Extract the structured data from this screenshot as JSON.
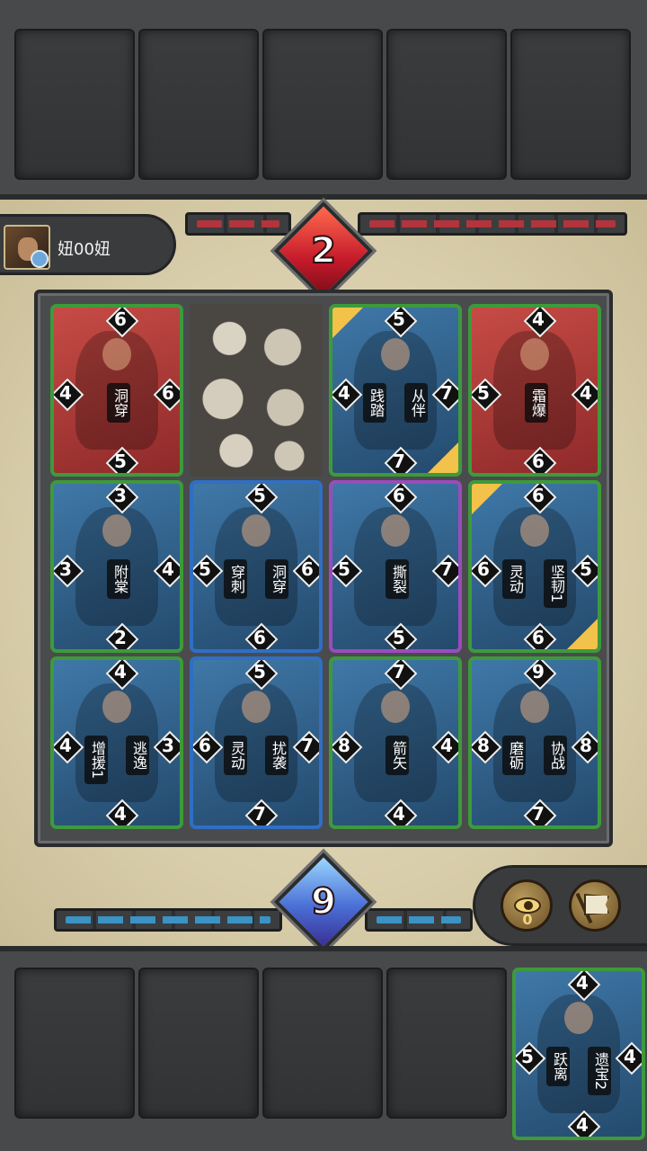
{
  "opponent": {
    "name": "妞00妞",
    "score": "2"
  },
  "player": {
    "score": "9",
    "view_count": "0"
  },
  "board": [
    {
      "owner": "red",
      "top": "6",
      "left": "4",
      "right": "6",
      "bottom": "5",
      "abilities": [
        "洞穿"
      ],
      "ability_pos": [
        "center"
      ]
    },
    {
      "owner": "stone"
    },
    {
      "owner": "blue",
      "top": "5",
      "left": "4",
      "right": "7",
      "bottom": "7",
      "abilities": [
        "践踏",
        "从伴"
      ],
      "ability_pos": [
        "left",
        "right"
      ]
    },
    {
      "owner": "red",
      "top": "4",
      "left": "5",
      "right": "4",
      "bottom": "6",
      "abilities": [
        "霜爆"
      ],
      "ability_pos": [
        "center"
      ]
    },
    {
      "owner": "blue",
      "top": "3",
      "left": "3",
      "right": "4",
      "bottom": "2",
      "abilities": [
        "附棠"
      ],
      "ability_pos": [
        "center"
      ]
    },
    {
      "owner": "blue",
      "top": "5",
      "left": "5",
      "right": "6",
      "bottom": "6",
      "abilities": [
        "穿刺",
        "洞穿"
      ],
      "ability_pos": [
        "left",
        "right"
      ]
    },
    {
      "owner": "blue",
      "top": "6",
      "left": "5",
      "right": "7",
      "bottom": "5",
      "abilities": [
        "撕裂"
      ],
      "ability_pos": [
        "center"
      ]
    },
    {
      "owner": "blue",
      "top": "6",
      "left": "6",
      "right": "5",
      "bottom": "6",
      "abilities": [
        "灵动",
        "坚韧1"
      ],
      "ability_pos": [
        "left",
        "right"
      ]
    },
    {
      "owner": "blue",
      "top": "4",
      "left": "4",
      "right": "3",
      "bottom": "4",
      "abilities": [
        "增援1",
        "逃逸"
      ],
      "ability_pos": [
        "left",
        "right"
      ]
    },
    {
      "owner": "blue",
      "top": "5",
      "left": "6",
      "right": "7",
      "bottom": "7",
      "abilities": [
        "灵动",
        "扰袭"
      ],
      "ability_pos": [
        "left",
        "right"
      ]
    },
    {
      "owner": "blue",
      "top": "7",
      "left": "8",
      "right": "4",
      "bottom": "4",
      "abilities": [
        "箭矢"
      ],
      "ability_pos": [
        "center"
      ]
    },
    {
      "owner": "blue",
      "top": "9",
      "left": "8",
      "right": "8",
      "bottom": "7",
      "abilities": [
        "磨砺",
        "协战"
      ],
      "ability_pos": [
        "left",
        "right"
      ]
    }
  ],
  "hand": [
    {
      "top": "4",
      "left": "5",
      "right": "4",
      "bottom": "4",
      "abilities": [
        "跃离",
        "遗宝2"
      ]
    }
  ]
}
